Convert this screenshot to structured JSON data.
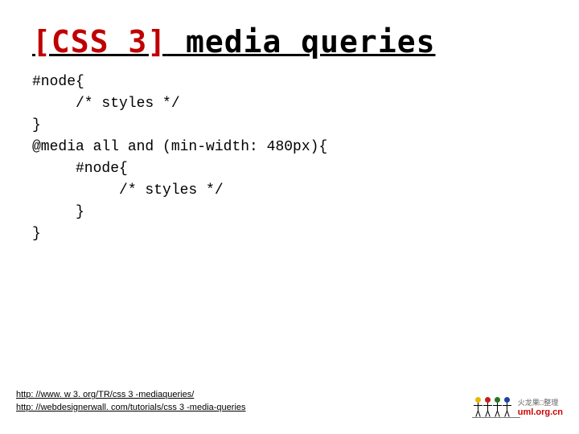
{
  "title": {
    "bracket": "[CSS 3]",
    "rest": " media queries"
  },
  "code": "#node{\n     /* styles */\n}\n@media all and (min-width: 480px){\n     #node{\n          /* styles */\n     }\n}",
  "links": [
    "http: //www. w 3. org/TR/css 3 -mediaqueries/",
    "http: //webdesignerwall. com/tutorials/css 3 -media-queries"
  ],
  "logo": {
    "tagline": "火龙果□整理",
    "brand": "uml.org.cn"
  },
  "figure_colors": [
    "#e8b800",
    "#c41e1e",
    "#1e7a1e",
    "#1e3fa8"
  ]
}
